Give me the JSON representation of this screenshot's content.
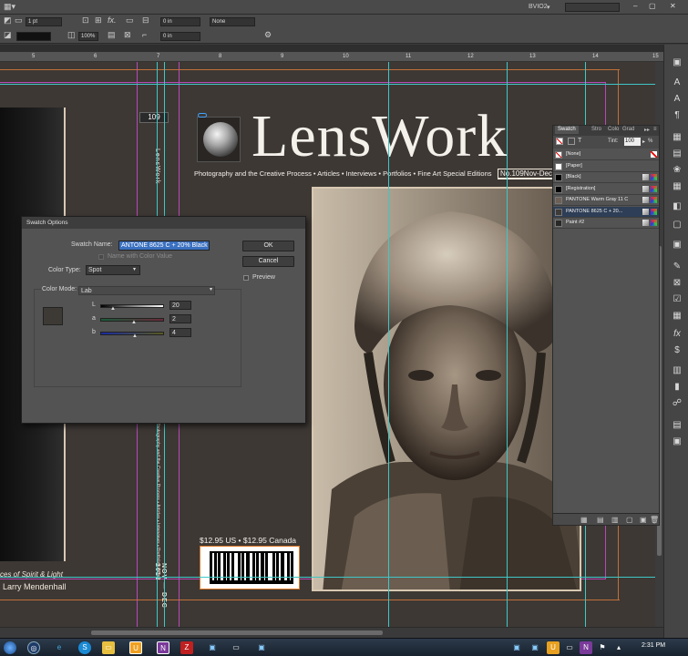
{
  "app": {
    "workspace": "BVIO2",
    "window_controls": [
      "–",
      "▢",
      "✕"
    ]
  },
  "control_bar": {
    "stroke_weight": "1 pt",
    "zoom": "100%",
    "offset": "0 in",
    "stroke_style": "None"
  },
  "ruler": {
    "ticks": [
      "5",
      "6",
      "7",
      "8",
      "9",
      "10",
      "11",
      "12",
      "13",
      "14",
      "15"
    ]
  },
  "document": {
    "logo_text": "LensWork",
    "tagline": "Photography and the Creative Process • Articles • Interviews • Portfolios • Fine Art Special Editions",
    "issue": "No.109Nov-Dec",
    "spine_issue": "109",
    "spine_title": "LensWork",
    "spine_middle": "Photography and the Creative Process • Articles • Interviews • Portfolios • Fine Art Special Editions",
    "spine_date": "NOV — DEC 2013",
    "price": "$12.95 US • $12.95 Canada",
    "left_caption_1": "ces of Spirit & Light",
    "left_caption_2": "Larry Mendenhall"
  },
  "swatches_panel": {
    "tabs": [
      "Swatch",
      "Stro",
      "Colo",
      "Grad"
    ],
    "tint_label": "Tint:",
    "tint_value": "100",
    "tint_unit": "%",
    "rows": [
      {
        "name": "[None]",
        "color": "#ffffff",
        "selected": false
      },
      {
        "name": "[Paper]",
        "color": "#ffffff",
        "selected": false
      },
      {
        "name": "[Black]",
        "color": "#000000",
        "selected": false
      },
      {
        "name": "[Registration]",
        "color": "#000000",
        "selected": false
      },
      {
        "name": "PANTONE Warm Gray 11 C",
        "color": "#6e5f55",
        "selected": false
      },
      {
        "name": "PANTONE 8625 C + 20...",
        "color": "#3d3a37",
        "selected": true
      },
      {
        "name": "Paint #2",
        "color": "#2a2826",
        "selected": false
      }
    ]
  },
  "dialog": {
    "title": "Swatch Options",
    "swatch_name_label": "Swatch Name:",
    "swatch_name_value": "ANTONE 8625 C + 20% Black",
    "name_with_color_value_label": "Name with Color Value",
    "color_type_label": "Color Type:",
    "color_type_value": "Spot",
    "color_mode_label": "Color Mode:",
    "color_mode_value": "Lab",
    "ok_label": "OK",
    "cancel_label": "Cancel",
    "preview_label": "Preview",
    "channels": [
      {
        "label": "L",
        "value": "20"
      },
      {
        "label": "a",
        "value": "2"
      },
      {
        "label": "b",
        "value": "4"
      }
    ],
    "swatch_preview_color": "#3d3a35"
  },
  "taskbar": {
    "clock": "2:31 PM"
  }
}
